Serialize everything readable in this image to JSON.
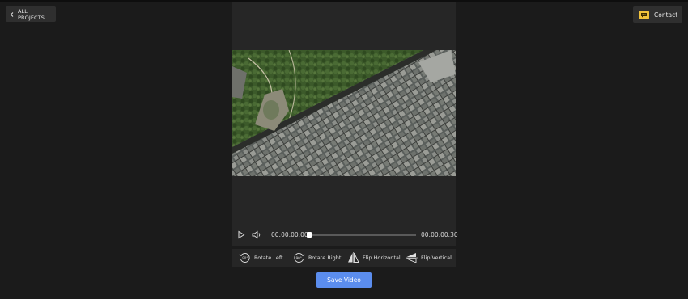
{
  "header": {
    "back_label": "ALL PROJECTS",
    "contact_label": "Contact"
  },
  "player": {
    "current_time": "00:00:00.00",
    "total_time": "00:00:00.30",
    "progress": 0.0
  },
  "tools": {
    "rotate_left": "Rotate Left",
    "rotate_right": "Rotate Right",
    "flip_horizontal": "Flip Horizontal",
    "flip_vertical": "Flip Vertical",
    "rotate_left_badge": "90°",
    "rotate_right_badge": "90°"
  },
  "actions": {
    "save_label": "Save Video"
  },
  "colors": {
    "background": "#1b1b1b",
    "panel": "#262626",
    "accent": "#5b8dee",
    "contact_icon": "#f0c23b"
  },
  "icons": {
    "back": "chevron-left-icon",
    "contact": "chat-icon",
    "play": "play-icon",
    "volume": "volume-icon",
    "rotate_left": "rotate-left-icon",
    "rotate_right": "rotate-right-icon",
    "flip_horizontal": "flip-horizontal-icon",
    "flip_vertical": "flip-vertical-icon"
  }
}
